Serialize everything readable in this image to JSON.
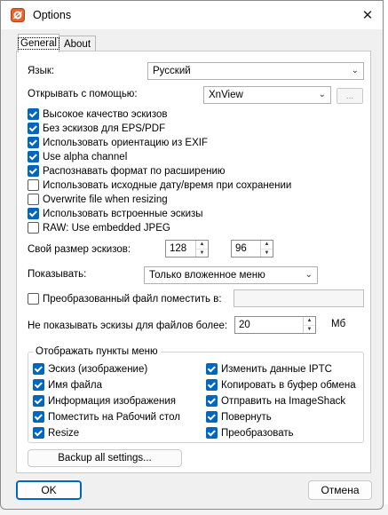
{
  "window": {
    "title": "Options",
    "close_glyph": "✕"
  },
  "tabs": [
    {
      "label": "General",
      "active": true
    },
    {
      "label": "About",
      "active": false
    }
  ],
  "general": {
    "language_label": "Язык:",
    "language_value": "Русский",
    "open_with_label": "Открывать с помощью:",
    "open_with_value": "XnView",
    "browse_label": "...",
    "checkboxes": [
      {
        "label": "Высокое качество эскизов",
        "checked": true
      },
      {
        "label": "Без эскизов для EPS/PDF",
        "checked": true
      },
      {
        "label": "Использовать ориентацию из EXIF",
        "checked": true
      },
      {
        "label": "Use alpha channel",
        "checked": true
      },
      {
        "label": "Распознавать формат по расширению",
        "checked": true
      },
      {
        "label": "Использовать исходные дату/время при сохранении",
        "checked": false
      },
      {
        "label": "Overwrite file when resizing",
        "checked": false
      },
      {
        "label": "Использовать встроенные эскизы",
        "checked": true
      },
      {
        "label": "RAW: Use embedded JPEG",
        "checked": false
      }
    ],
    "thumb_size_label": "Свой размер эскизов:",
    "thumb_width": "128",
    "thumb_height": "96",
    "show_label": "Показывать:",
    "show_value": "Только вложенное меню",
    "converted_label": "Преобразованный файл поместить в:",
    "converted_checked": false,
    "converted_value": "",
    "max_size_label": "Не показывать эскизы для файлов более:",
    "max_size_value": "20",
    "max_size_unit": "Мб",
    "menu_group_title": "Отображать пункты меню",
    "menu_items_left": [
      {
        "label": "Эскиз (изображение)",
        "checked": true
      },
      {
        "label": "Имя файла",
        "checked": true
      },
      {
        "label": "Информация изображения",
        "checked": true
      },
      {
        "label": "Поместить на Рабочий стол",
        "checked": true
      },
      {
        "label": "Resize",
        "checked": true
      }
    ],
    "menu_items_right": [
      {
        "label": "Изменить данные IPTC",
        "checked": true
      },
      {
        "label": "Копировать в буфер обмена",
        "checked": true
      },
      {
        "label": "Отправить на ImageShack",
        "checked": true
      },
      {
        "label": "Повернуть",
        "checked": true
      },
      {
        "label": "Преобразовать",
        "checked": true
      }
    ],
    "backup_label": "Backup all settings..."
  },
  "footer": {
    "ok_label": "OK",
    "cancel_label": "Отмена"
  },
  "colors": {
    "accent": "#0067c0"
  }
}
